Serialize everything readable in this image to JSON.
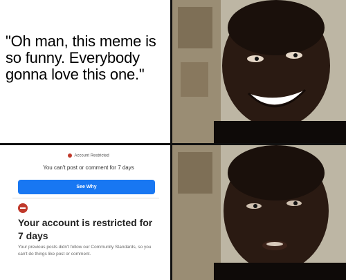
{
  "caption": "\"Oh man, this meme is so funny. Everybody gonna love this one.\"",
  "restriction_card": {
    "header": "Account Restricted",
    "message": "You can't post or comment for 7 days",
    "button_label": "See Why"
  },
  "notice": {
    "title": "Your account is restricted for 7 days",
    "body": "Your previous posts didn't follow our Community Standards, so you can't do things like post or comment."
  },
  "colors": {
    "button": "#1877f2",
    "warning": "#c0392b"
  }
}
